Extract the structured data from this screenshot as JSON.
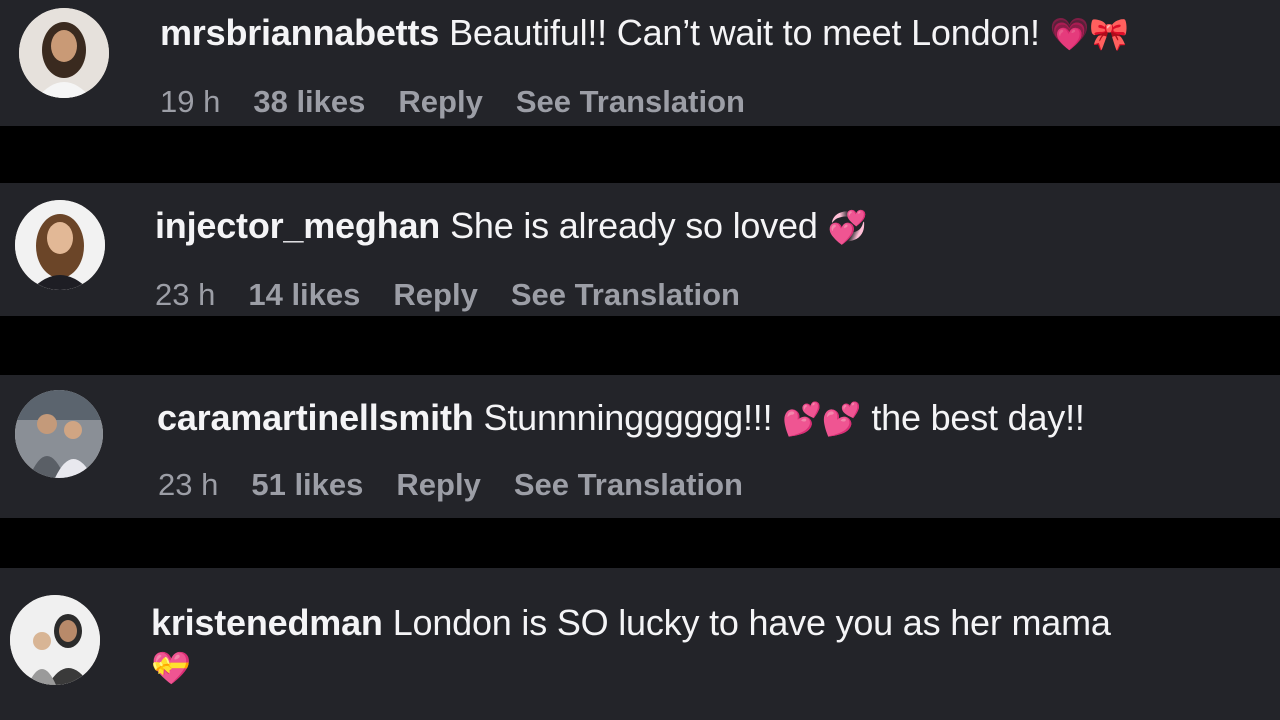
{
  "comments": [
    {
      "username": "mrsbriannabetts",
      "text": "Beautiful!! Can’t wait to meet London!",
      "emoji": "💗🎀",
      "time": "19 h",
      "likes": "38 likes",
      "reply": "Reply",
      "translate": "See Translation"
    },
    {
      "username": "injector_meghan",
      "text": "She is already so loved",
      "emoji": "💞",
      "time": "23 h",
      "likes": "14 likes",
      "reply": "Reply",
      "translate": "See Translation"
    },
    {
      "username": "caramartinellsmith",
      "text": "Stunnningggggg!!!",
      "emoji": "💕💕",
      "text2": "the best day!!",
      "time": "23 h",
      "likes": "51 likes",
      "reply": "Reply",
      "translate": "See Translation"
    },
    {
      "username": "kristenedman",
      "text": "London is SO lucky to have you as her mama",
      "emoji": "💝"
    }
  ],
  "colors": {
    "background": "#000000",
    "card": "#232429",
    "text": "#f4f4f6",
    "meta": "#9c9ea6"
  }
}
